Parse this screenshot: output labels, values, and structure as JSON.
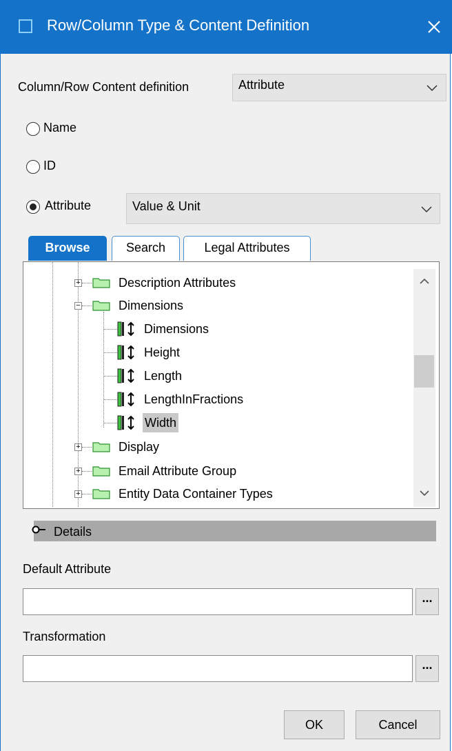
{
  "window": {
    "title": "Row/Column Type & Content Definition",
    "accent_color": "#1473c8",
    "close_icon": "close-icon"
  },
  "content_definition": {
    "label": "Column/Row Content definition",
    "selected": "Attribute"
  },
  "radios": {
    "name_label": "Name",
    "id_label": "ID",
    "attribute_label": "Attribute",
    "selected": "Attribute"
  },
  "attribute_type": {
    "selected": "Value & Unit"
  },
  "tabs": [
    {
      "label": "Browse",
      "active": true
    },
    {
      "label": "Search",
      "active": false
    },
    {
      "label": "Legal Attributes",
      "active": false
    }
  ],
  "tree": {
    "items": [
      {
        "label": "Description Attributes",
        "type": "folder",
        "expanded": false
      },
      {
        "label": "Dimensions",
        "type": "folder",
        "expanded": true
      },
      {
        "label": "Dimensions",
        "type": "attribute"
      },
      {
        "label": "Height",
        "type": "attribute"
      },
      {
        "label": "Length",
        "type": "attribute"
      },
      {
        "label": "LengthInFractions",
        "type": "attribute"
      },
      {
        "label": "Width",
        "type": "attribute",
        "selected": true
      },
      {
        "label": "Display",
        "type": "folder",
        "expanded": false
      },
      {
        "label": "Email Attribute Group",
        "type": "folder",
        "expanded": false
      },
      {
        "label": "Entity Data Container Types",
        "type": "folder",
        "expanded": false
      }
    ]
  },
  "details": {
    "label": "Details"
  },
  "default_attribute": {
    "label": "Default Attribute",
    "value": "",
    "browse_label": "..."
  },
  "transformation": {
    "label": "Transformation",
    "value": "",
    "browse_label": "..."
  },
  "buttons": {
    "ok": "OK",
    "cancel": "Cancel"
  }
}
